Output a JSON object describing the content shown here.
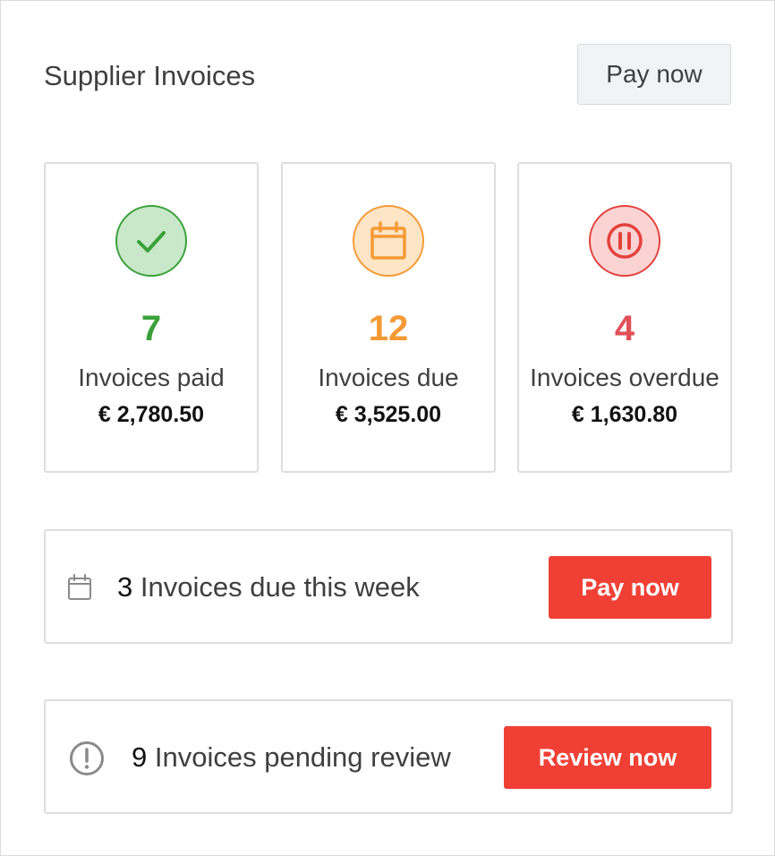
{
  "header": {
    "title": "Supplier Invoices",
    "pay_button_label": "Pay now"
  },
  "stats": [
    {
      "icon": "check-icon",
      "count": "7",
      "label": "Invoices paid",
      "amount": "€ 2,780.50",
      "color": "#3aa13a"
    },
    {
      "icon": "calendar-icon",
      "count": "12",
      "label": "Invoices due",
      "amount": "€ 3,525.00",
      "color": "#f49a35"
    },
    {
      "icon": "pause-icon",
      "count": "4",
      "label": "Invoices overdue",
      "amount": "€ 1,630.80",
      "color": "#e0515a"
    }
  ],
  "rows": [
    {
      "icon": "calendar-icon",
      "count": "3",
      "text": "Invoices due this week",
      "button_label": "Pay now"
    },
    {
      "icon": "alert-icon",
      "count": "9",
      "text": "Invoices pending review",
      "button_label": "Review now"
    }
  ],
  "colors": {
    "accent_button": "#f04036",
    "paid": "#3aa13a",
    "due": "#f49a35",
    "overdue": "#e0515a"
  }
}
